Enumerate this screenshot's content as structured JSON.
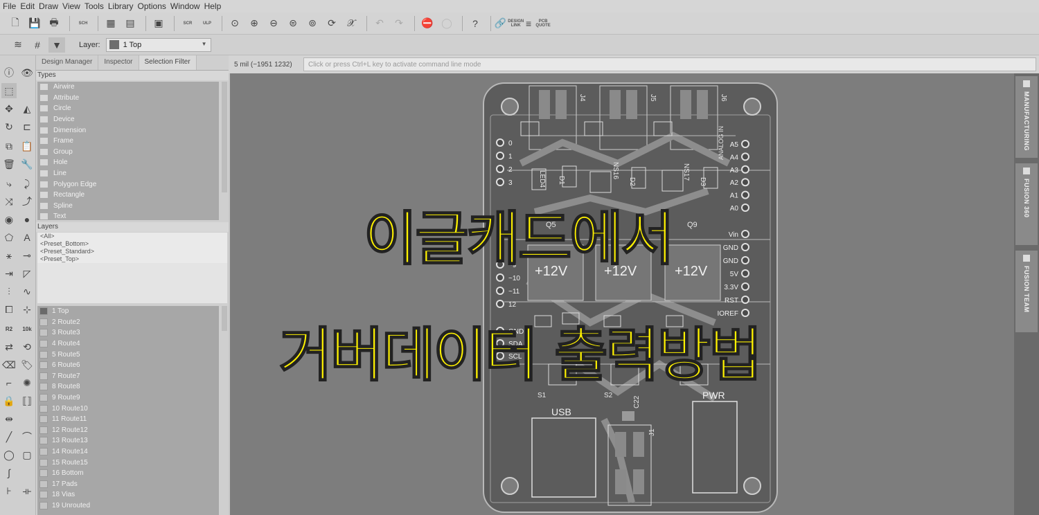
{
  "menu": [
    "File",
    "Edit",
    "Draw",
    "View",
    "Tools",
    "Library",
    "Options",
    "Window",
    "Help"
  ],
  "toolbar": {
    "sch_label": "SCH",
    "scr_label": "SCR",
    "ulp_label": "ULP",
    "design_link": "DESIGN LINK",
    "pcb_quote": "PCB QUOTE"
  },
  "layer_selector": {
    "label": "Layer:",
    "value": "1 Top"
  },
  "panel": {
    "tabs": [
      "Design Manager",
      "Inspector",
      "Selection Filter"
    ],
    "types_title": "Types",
    "types": [
      "Airwire",
      "Attribute",
      "Circle",
      "Device",
      "Dimension",
      "Frame",
      "Group",
      "Hole",
      "Line",
      "Polygon Edge",
      "Rectangle",
      "Spline",
      "Text"
    ],
    "layers_title": "Layers",
    "presets": [
      "<All>",
      "<Preset_Bottom>",
      "<Preset_Standard>",
      "<Preset_Top>"
    ],
    "layers": [
      "1 Top",
      "2 Route2",
      "3 Route3",
      "4 Route4",
      "5 Route5",
      "6 Route6",
      "7 Route7",
      "8 Route8",
      "9 Route9",
      "10 Route10",
      "11 Route11",
      "12 Route12",
      "13 Route13",
      "14 Route14",
      "15 Route15",
      "16 Bottom",
      "17 Pads",
      "18 Vias",
      "19 Unrouted"
    ]
  },
  "command": {
    "coordinates": "5 mil (−1951 1232)",
    "placeholder": "Click or press Ctrl+L key to activate command line mode"
  },
  "right_tabs": [
    "MANUFACTURING",
    "FUSION 360",
    "FUSION TEAM"
  ],
  "pcb": {
    "connectors": [
      "J4",
      "J5",
      "J6",
      "J1"
    ],
    "left_pins": [
      "0",
      "1",
      "2",
      "3",
      "~9",
      "~10",
      "~11",
      "12",
      "GND",
      "SDA",
      "SCL"
    ],
    "right_pins": [
      "A5",
      "A4",
      "A3",
      "A2",
      "A1",
      "A0",
      "Vin",
      "GND",
      "GND",
      "5V",
      "3.3V",
      "RST",
      "IOREF"
    ],
    "analog_label": "ANALOG IN",
    "power_labels": [
      "+12V",
      "+12V",
      "+12V"
    ],
    "parts": [
      "D1",
      "D2",
      "D3",
      "NS16",
      "NS17",
      "LED4",
      "Q9",
      "Q5",
      "C22",
      "S1",
      "S2"
    ],
    "usb_label": "USB",
    "pwr_label": "PWR"
  },
  "title_overlay": {
    "line1": "이글캐드에서",
    "line2": "거버데이터 출력방법"
  }
}
